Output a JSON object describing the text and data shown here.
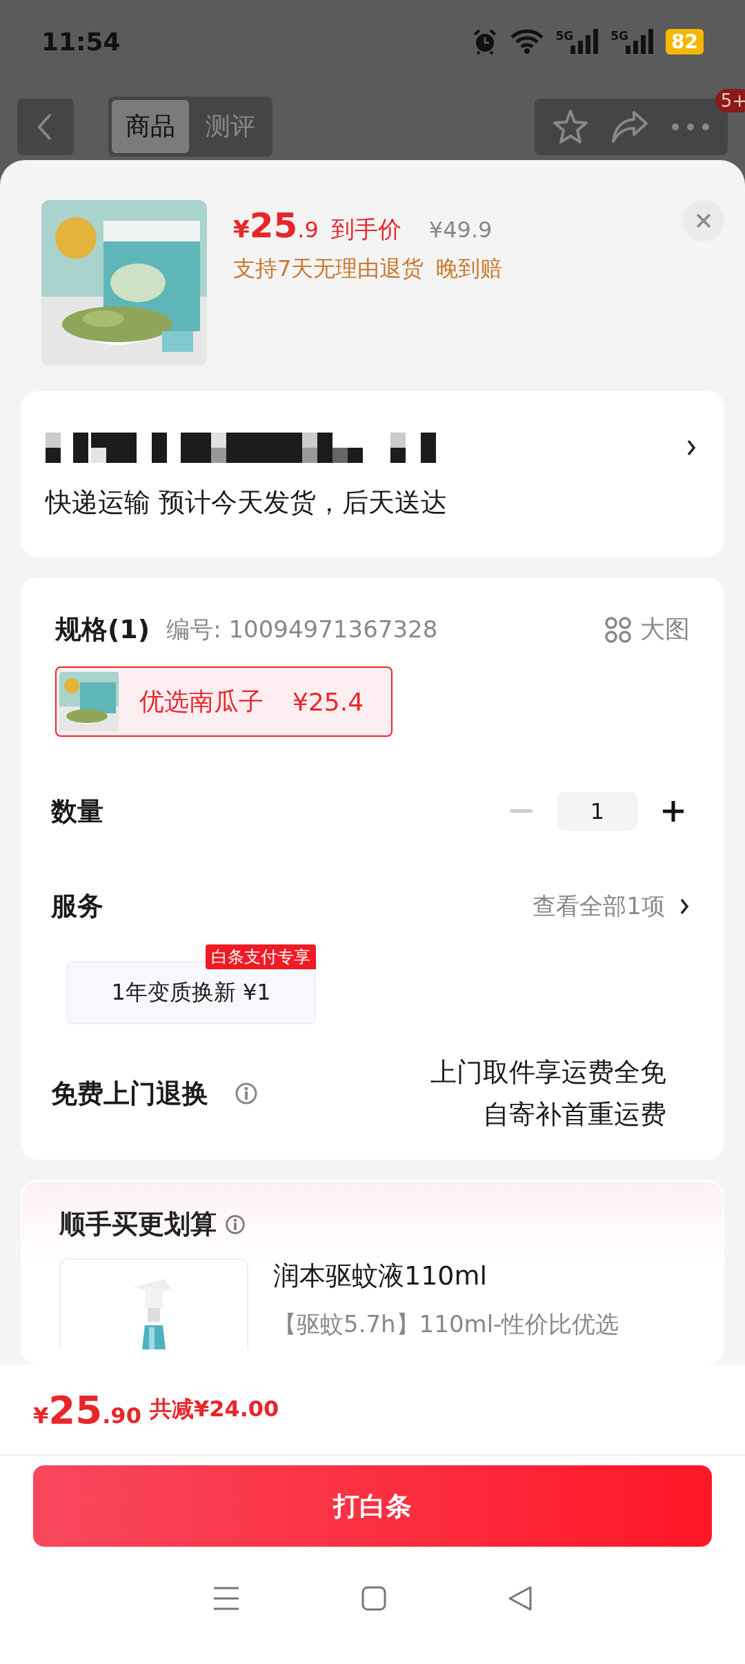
{
  "status_bar": {
    "time": "11:54",
    "sim": [
      "5G",
      "5G"
    ],
    "battery": "82"
  },
  "nav": {
    "tabs": [
      {
        "label": "商品",
        "selected": true
      },
      {
        "label": "测评",
        "selected": false
      }
    ],
    "badge": "5+"
  },
  "product": {
    "currency": "¥",
    "price_int": "25",
    "price_dec": ".9",
    "price_label": "到手价",
    "original_price": "¥49.9",
    "promises": [
      "支持7天无理由退货",
      "晚到赔"
    ]
  },
  "delivery": {
    "text": "快递运输 预计今天发货，后天送达"
  },
  "spec": {
    "title": "规格(1)",
    "code": "编号: 10094971367328",
    "big_image": "大图",
    "options": [
      {
        "label": "优选南瓜子",
        "price": "¥25.4",
        "selected": true
      }
    ]
  },
  "quantity": {
    "label": "数量",
    "value": "1",
    "decrease_disabled": true
  },
  "service": {
    "title": "服务",
    "view_all": "查看全部1项",
    "options": [
      {
        "label": "1年变质换新 ¥1",
        "tag": "白条支付专享",
        "selected": false
      }
    ]
  },
  "returns": {
    "title": "免费上门退换",
    "lines": [
      "上门取件享运费全免",
      "自寄补首重运费"
    ]
  },
  "addon": {
    "title": "顺手买更划算",
    "items": [
      {
        "name": "润本驱蚊液110ml",
        "desc": "【驱蚊5.7h】110ml-性价比优选"
      }
    ]
  },
  "footer": {
    "currency": "¥",
    "price_int": "25",
    "price_dec": ".90",
    "saving": "共减¥24.00",
    "button": "打白条"
  }
}
